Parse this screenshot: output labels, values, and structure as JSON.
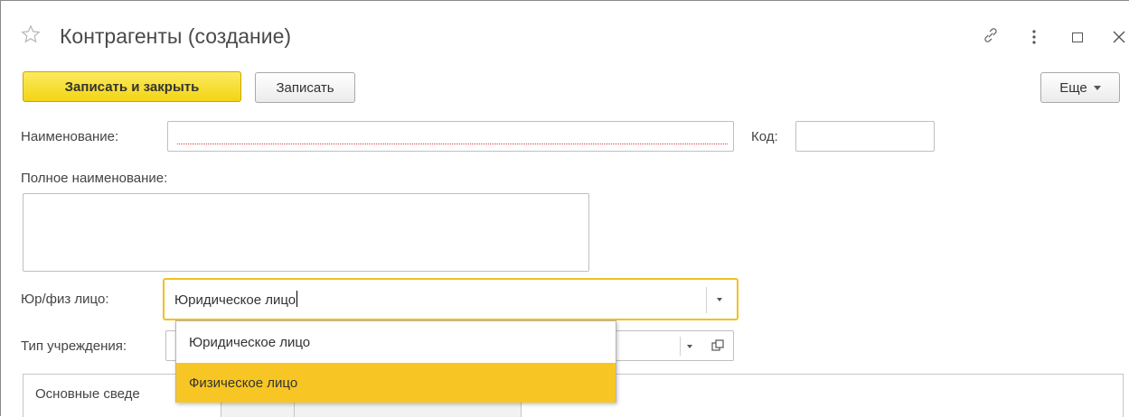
{
  "window": {
    "title": "Контрагенты (создание)"
  },
  "toolbar": {
    "save_close_label": "Записать и закрыть",
    "save_label": "Записать",
    "more_label": "Еще"
  },
  "form": {
    "name_label": "Наименование:",
    "name_value": "",
    "code_label": "Код:",
    "code_value": "",
    "full_name_label": "Полное наименование:",
    "full_name_value": "",
    "legal_type_label": "Юр/физ лицо:",
    "legal_type_value": "Юридическое лицо",
    "institution_type_label": "Тип учреждения:"
  },
  "dropdown": {
    "options": [
      "Юридическое лицо",
      "Физическое лицо"
    ],
    "highlighted_index": 1
  },
  "tabs": {
    "main_label": "Основные сведе"
  },
  "colors": {
    "accent_yellow": "#f7c624",
    "primary_button": "#f3d514",
    "invalid_red": "#e03a3a"
  }
}
